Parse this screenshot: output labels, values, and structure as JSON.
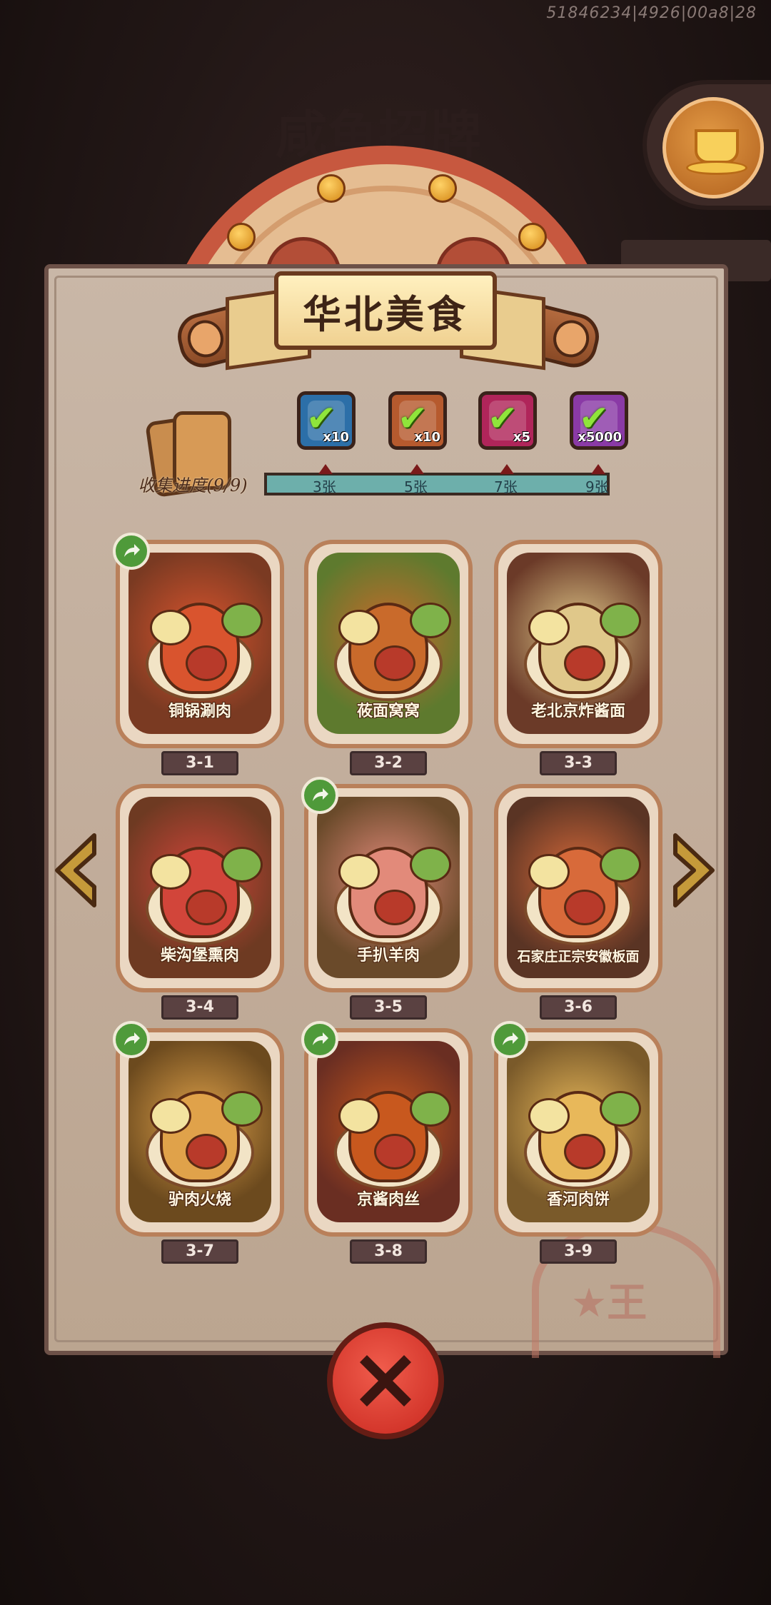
{
  "debug_text": "51846234|4926|00a8|28",
  "background_title": "咸鱼招牌",
  "panel": {
    "title": "华北美食",
    "collection_label": "收集进度(9/9)",
    "collection_progress": 1.0
  },
  "rewards": [
    {
      "icon": "treasure-chest-icon",
      "qty": "x10",
      "color": "#2c6fa8",
      "claimed": true
    },
    {
      "icon": "shovel-icon",
      "qty": "x10",
      "color": "#b65a2e",
      "claimed": true
    },
    {
      "icon": "gem-orb-icon",
      "qty": "x5",
      "color": "#b0255a",
      "claimed": true
    },
    {
      "icon": "silver-ingot-icon",
      "qty": "x5000",
      "color": "#8a3aa6",
      "claimed": true
    }
  ],
  "milestones": [
    "3张",
    "5张",
    "7张",
    "9张"
  ],
  "dishes": [
    {
      "name": "铜锅涮肉",
      "code": "3-1",
      "shareable": true,
      "bg": "#7a3a22",
      "food": "#d9542e"
    },
    {
      "name": "莜面窝窝",
      "code": "3-2",
      "shareable": false,
      "bg": "#5e7a2e",
      "food": "#c96a2b"
    },
    {
      "name": "老北京炸酱面",
      "code": "3-3",
      "shareable": false,
      "bg": "#6b3a28",
      "food": "#e0c88a"
    },
    {
      "name": "柴沟堡熏肉",
      "code": "3-4",
      "shareable": false,
      "bg": "#6e3a22",
      "food": "#d2453a"
    },
    {
      "name": "手扒羊肉",
      "code": "3-5",
      "shareable": true,
      "bg": "#6a4a2a",
      "food": "#e28a7a"
    },
    {
      "name": "石家庄正宗安徽板面",
      "code": "3-6",
      "shareable": false,
      "bg": "#5a3424",
      "food": "#d86a3a"
    },
    {
      "name": "驴肉火烧",
      "code": "3-7",
      "shareable": true,
      "bg": "#6c4a1e",
      "food": "#e0a24a"
    },
    {
      "name": "京酱肉丝",
      "code": "3-8",
      "shareable": true,
      "bg": "#6a2e22",
      "food": "#c8581e"
    },
    {
      "name": "香河肉饼",
      "code": "3-9",
      "shareable": true,
      "bg": "#7a5a2a",
      "food": "#e8b85a"
    }
  ],
  "colors": {
    "panel": "#c4ae9c",
    "close": "#e0392c",
    "share": "#4f9a3a"
  }
}
